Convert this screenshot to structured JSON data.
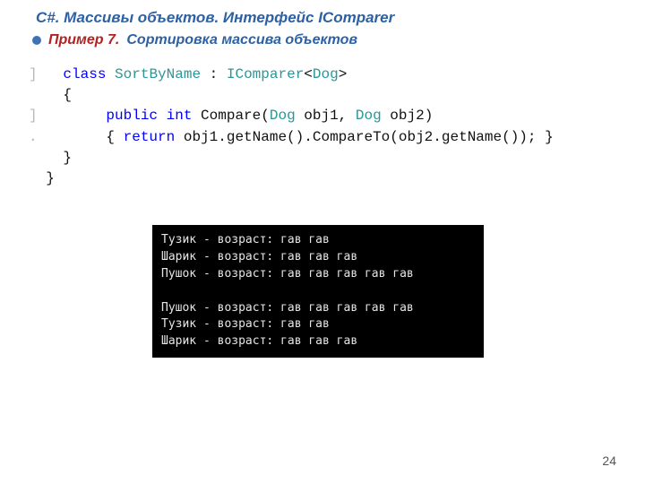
{
  "header": {
    "title": "С#. Массивы объектов. Интерфейс IComparer",
    "example_label": "Пример 7.",
    "example_title": "Сортировка массива объектов"
  },
  "code": {
    "gutter": {
      "r1": "]",
      "r3": "]",
      "r4": "."
    },
    "line1": {
      "kw": "class",
      "name": "SortByName",
      "colon": " : ",
      "iface": "IComparer",
      "lt": "<",
      "T": "Dog",
      "gt": ">"
    },
    "line2": "    {",
    "line3": {
      "pad": "        ",
      "mods": "public int",
      "sp": " ",
      "method": "Compare(",
      "t1": "Dog",
      "a1": " obj1, ",
      "t2": "Dog",
      "a2": " obj2)"
    },
    "line4": {
      "pad": "        ",
      "open": "{ ",
      "ret": "return",
      "rest": " obj1.getName().CompareTo(obj2.getName()); }"
    },
    "line5": "    }",
    "line6": "  }"
  },
  "console": {
    "group1": [
      "Тузик - возраст: гав гав",
      "Шарик - возраст: гав гав гав",
      "Пушок - возраст: гав гав гав гав гав"
    ],
    "group2": [
      "Пушок - возраст: гав гав гав гав гав",
      "Тузик - возраст: гав гав",
      "Шарик - возраст: гав гав гав"
    ]
  },
  "page_number": "24"
}
